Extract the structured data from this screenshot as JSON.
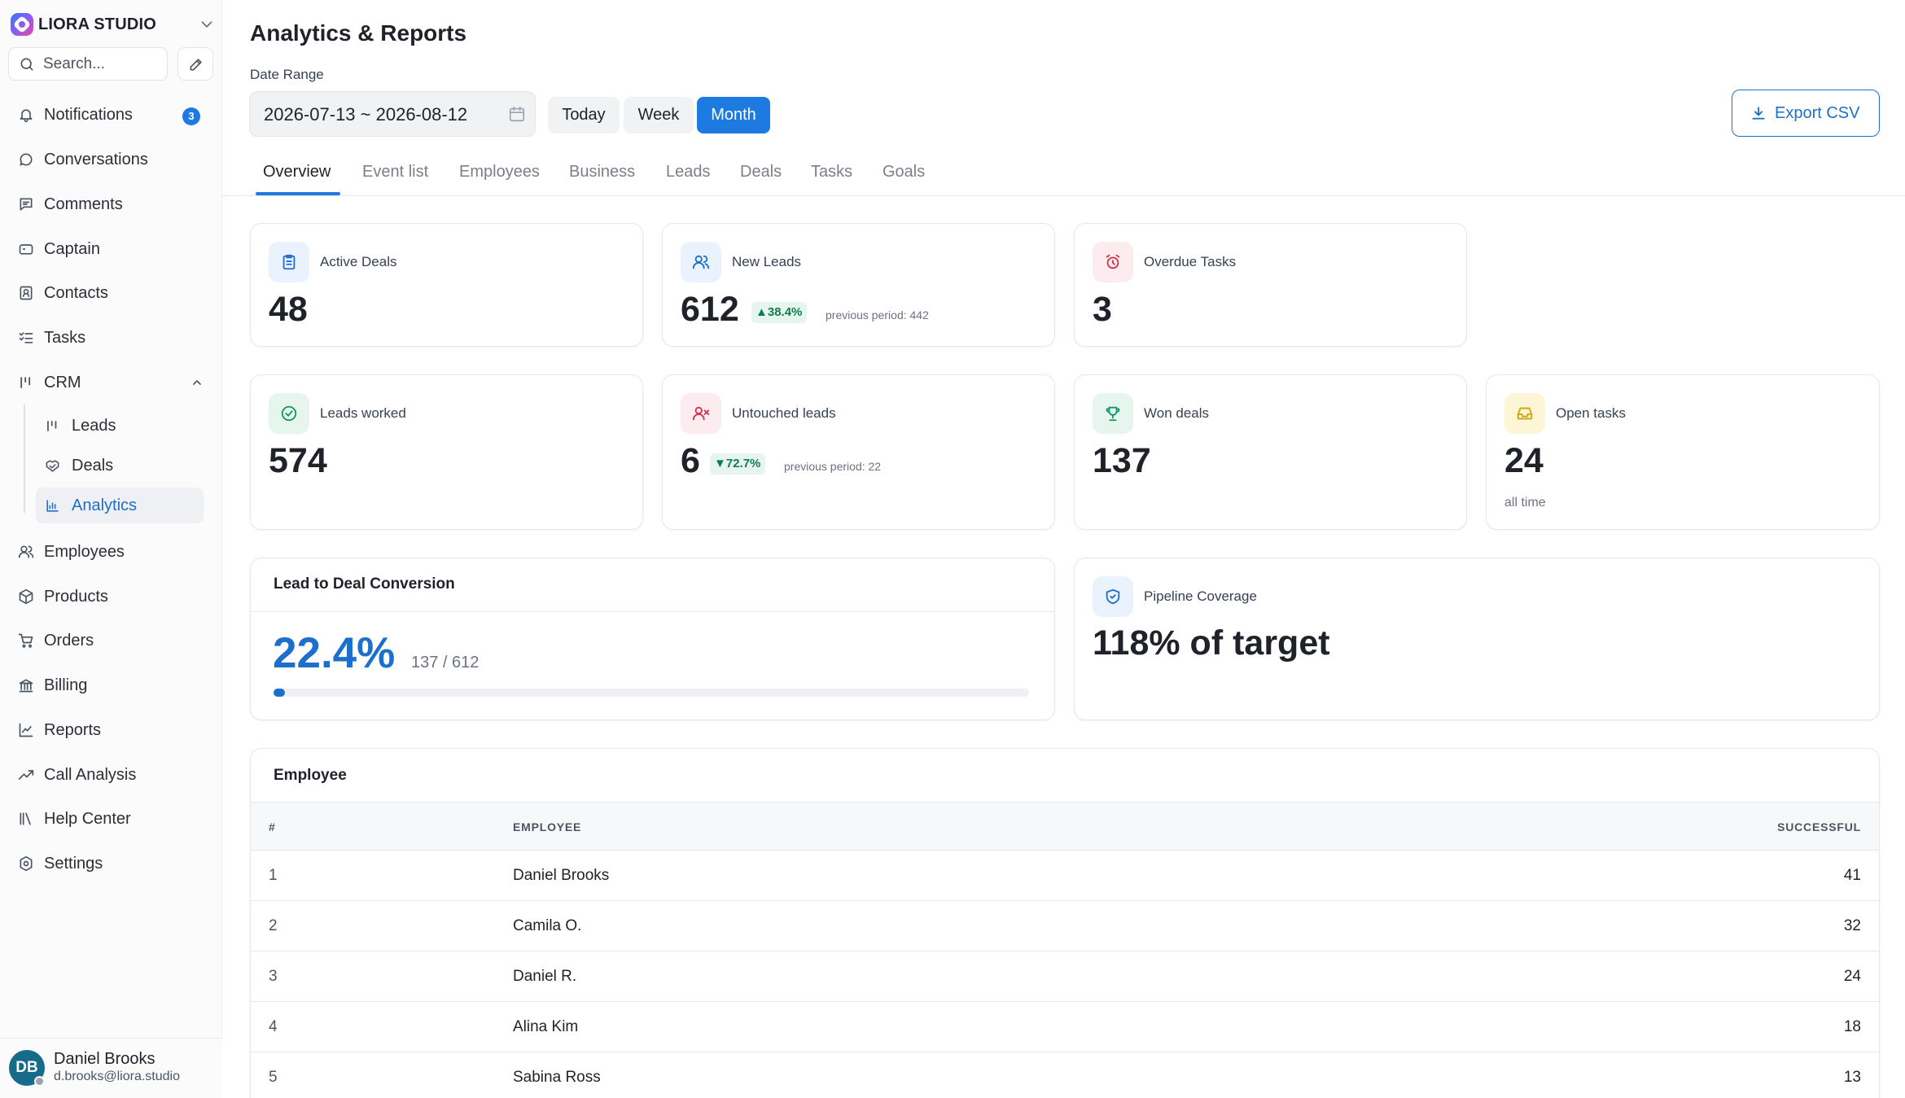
{
  "brand": {
    "name": "LIORA STUDIO"
  },
  "search": {
    "placeholder": "Search..."
  },
  "nav": {
    "notifications": {
      "label": "Notifications",
      "badge": "3"
    },
    "conversations": "Conversations",
    "comments": "Comments",
    "captain": "Captain",
    "contacts": "Contacts",
    "tasks": "Tasks",
    "crm": "CRM",
    "crm_sub": {
      "leads": "Leads",
      "deals": "Deals",
      "analytics": "Analytics"
    },
    "employees": "Employees",
    "products": "Products",
    "orders": "Orders",
    "billing": "Billing",
    "reports": "Reports",
    "call_analysis": "Call Analysis",
    "help_center": "Help Center",
    "settings": "Settings"
  },
  "user": {
    "initials": "DB",
    "name": "Daniel Brooks",
    "email": "d.brooks@liora.studio"
  },
  "header": {
    "title": "Analytics & Reports",
    "date_range_label": "Date Range",
    "date_range_value": "2026-07-13 ~ 2026-08-12",
    "presets": {
      "today": "Today",
      "week": "Week",
      "month": "Month"
    },
    "active_preset": "Month",
    "export_label": "Export CSV"
  },
  "tabs": [
    "Overview",
    "Event list",
    "Employees",
    "Business",
    "Leads",
    "Deals",
    "Tasks",
    "Goals"
  ],
  "active_tab": "Overview",
  "kpis": {
    "active_deals": {
      "title": "Active Deals",
      "value": "48"
    },
    "new_leads": {
      "title": "New Leads",
      "value": "612",
      "change": "38.4%",
      "direction": "up",
      "previous": "previous period: 442"
    },
    "overdue_tasks": {
      "title": "Overdue Tasks",
      "value": "3"
    },
    "leads_worked": {
      "title": "Leads worked",
      "value": "574"
    },
    "untouched_leads": {
      "title": "Untouched leads",
      "value": "6",
      "change": "72.7%",
      "direction": "down",
      "previous": "previous period: 22"
    },
    "won_deals": {
      "title": "Won deals",
      "value": "137"
    },
    "open_tasks": {
      "title": "Open tasks",
      "value": "24",
      "sub": "all time"
    }
  },
  "conversion": {
    "title": "Lead to Deal Conversion",
    "percent": "22.4%",
    "ratio": "137 / 612",
    "progress": 0.015
  },
  "pipeline": {
    "title": "Pipeline Coverage",
    "value": "118% of target"
  },
  "employee_table": {
    "title": "Employee",
    "columns": {
      "rank": "#",
      "employee": "EMPLOYEE",
      "successful": "SUCCESSFUL"
    },
    "rows": [
      {
        "rank": "1",
        "name": "Daniel Brooks",
        "successful": "41"
      },
      {
        "rank": "2",
        "name": "Camila O.",
        "successful": "32"
      },
      {
        "rank": "3",
        "name": "Daniel R.",
        "successful": "24"
      },
      {
        "rank": "4",
        "name": "Alina Kim",
        "successful": "18"
      },
      {
        "rank": "5",
        "name": "Sabina Ross",
        "successful": "13"
      }
    ]
  },
  "colors": {
    "accent": "#1d7ae0",
    "accent_dark": "#1d6fcc",
    "success_chip_bg": "#e6f6ef",
    "success_chip_text": "#127a55",
    "avatar": "#166a8a"
  }
}
